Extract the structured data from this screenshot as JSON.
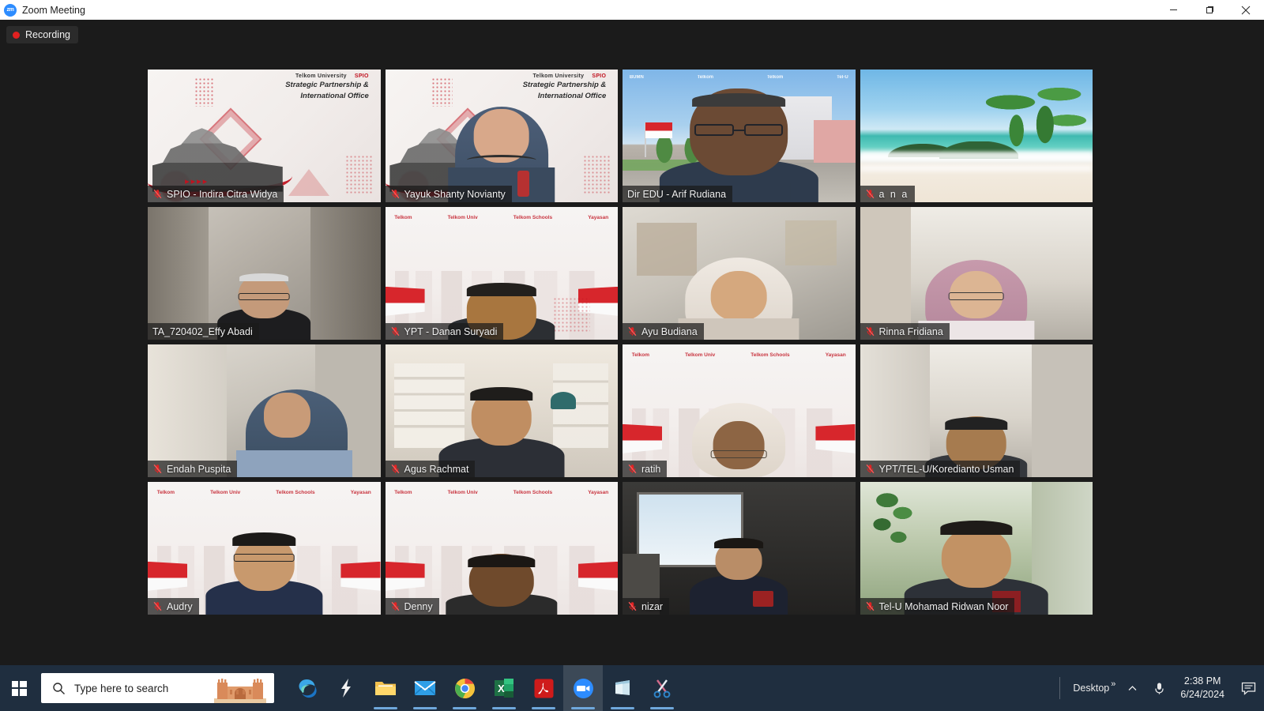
{
  "window": {
    "title": "Zoom Meeting",
    "logo_text": "zm",
    "controls": {
      "minimize": "minimize-button",
      "maximize": "maximize-button",
      "close": "close-button"
    }
  },
  "meeting": {
    "recording_label": "Recording",
    "recording_dot_color": "#e02020",
    "active_speaker_border_color": "#c6f23c",
    "background_color": "#1b1b1b",
    "grid": {
      "columns": 4,
      "rows": 4
    },
    "participants": [
      {
        "name": "SPIO - Indira Citra Widya",
        "muted": true,
        "active": false,
        "bg": "spio",
        "label": "Strategic Partnership &\nInternational Office"
      },
      {
        "name": "Yayuk Shanty Novianty",
        "muted": true,
        "active": false,
        "bg": "spio",
        "label": "Strategic Partnership &\nInternational Office"
      },
      {
        "name": "Dir EDU - Arif Rudiana",
        "muted": false,
        "active": true,
        "bg": "campus",
        "label": ""
      },
      {
        "name": "a n a",
        "muted": true,
        "active": false,
        "bg": "beach",
        "label": ""
      },
      {
        "name": "TA_720402_Effy Abadi",
        "muted": false,
        "active": false,
        "bg": "room-a",
        "label": ""
      },
      {
        "name": "YPT - Danan Suryadi",
        "muted": true,
        "active": false,
        "bg": "telkom",
        "label": ""
      },
      {
        "name": "Ayu Budiana",
        "muted": true,
        "active": false,
        "bg": "room-b",
        "label": ""
      },
      {
        "name": "Rinna Fridiana",
        "muted": true,
        "active": false,
        "bg": "room-c",
        "label": ""
      },
      {
        "name": "Endah Puspita",
        "muted": true,
        "active": false,
        "bg": "room-b",
        "label": ""
      },
      {
        "name": "Agus Rachmat",
        "muted": true,
        "active": false,
        "bg": "office",
        "label": ""
      },
      {
        "name": "ratih",
        "muted": true,
        "active": false,
        "bg": "telkom",
        "label": ""
      },
      {
        "name": "YPT/TEL-U/Koredianto Usman",
        "muted": true,
        "active": false,
        "bg": "room-c",
        "label": ""
      },
      {
        "name": "Audry",
        "muted": true,
        "active": false,
        "bg": "telkom",
        "label": ""
      },
      {
        "name": "Denny",
        "muted": true,
        "active": false,
        "bg": "telkom",
        "label": ""
      },
      {
        "name": "nizar",
        "muted": true,
        "active": false,
        "bg": "dark-room",
        "label": ""
      },
      {
        "name": "Tel-U Mohamad Ridwan Noor",
        "muted": true,
        "active": false,
        "bg": "green-room",
        "label": ""
      }
    ],
    "virtual_bg_text": {
      "spio_logo_1": "Telkom University",
      "spio_logo_2": "SPIO",
      "spio_heading": "Strategic Partnership & International Office",
      "telkom_logos": [
        "Telkom",
        "Telkom University",
        "Telkom Schools",
        "Yayasan Telkom"
      ],
      "campus_logos": [
        "BUMN",
        "Telkom University",
        "Telkom",
        "Tel-U"
      ]
    }
  },
  "taskbar": {
    "start_label": "Start",
    "search_placeholder": "Type here to search",
    "apps": [
      {
        "name": "Microsoft Edge",
        "icon": "edge-icon",
        "running": false,
        "active": false
      },
      {
        "name": "Shortcut",
        "icon": "lightning-icon",
        "running": false,
        "active": false
      },
      {
        "name": "File Explorer",
        "icon": "folder-icon",
        "running": true,
        "active": false
      },
      {
        "name": "Mail",
        "icon": "mail-icon",
        "running": true,
        "active": false
      },
      {
        "name": "Google Chrome",
        "icon": "chrome-icon",
        "running": true,
        "active": false
      },
      {
        "name": "Microsoft Excel",
        "icon": "excel-icon",
        "running": true,
        "active": false
      },
      {
        "name": "Adobe Acrobat",
        "icon": "acrobat-icon",
        "running": true,
        "active": false
      },
      {
        "name": "Zoom",
        "icon": "zoom-icon",
        "running": true,
        "active": true
      },
      {
        "name": "Microsoft Store",
        "icon": "store-icon",
        "running": true,
        "active": false
      },
      {
        "name": "Snipping Tool",
        "icon": "snip-icon",
        "running": true,
        "active": false
      }
    ],
    "tray": {
      "desktop_label": "Desktop",
      "overflow_glyph": "»",
      "show_hidden_glyph": "∧",
      "mic_icon": "microphone-icon",
      "time": "2:38 PM",
      "date": "6/24/2024",
      "action_center": "notifications-icon"
    }
  }
}
